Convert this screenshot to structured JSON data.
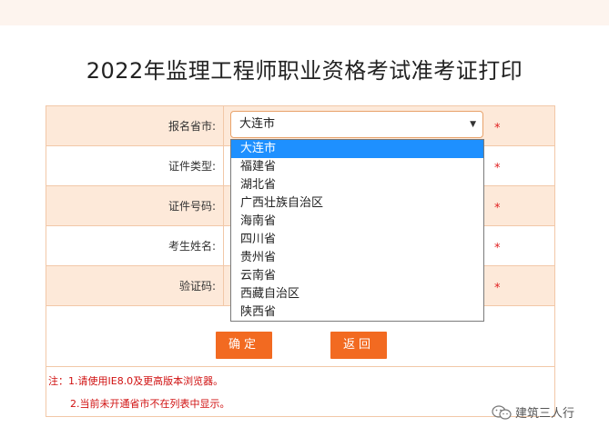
{
  "page": {
    "title": "2022年监理工程师职业资格考试准考证打印"
  },
  "form": {
    "rows": [
      {
        "label": "报名省市:"
      },
      {
        "label": "证件类型:"
      },
      {
        "label": "证件号码:"
      },
      {
        "label": "考生姓名:"
      },
      {
        "label": "验证码:"
      }
    ],
    "required_mark": "*",
    "province_select": {
      "value": "大连市",
      "options": [
        "大连市",
        "福建省",
        "湖北省",
        "广西壮族自治区",
        "海南省",
        "四川省",
        "贵州省",
        "云南省",
        "西藏自治区",
        "陕西省"
      ],
      "selected_index": 0
    }
  },
  "buttons": {
    "confirm": "确定",
    "back": "返回"
  },
  "notes": {
    "line1": "注：1.请使用IE8.0及更高版本浏览器。",
    "line2": "2.当前未开通省市不在列表中显示。"
  },
  "watermark": {
    "text": "建筑三人行"
  },
  "colors": {
    "accent": "#f26a21",
    "required": "#e02020",
    "row_alt": "#fde9d9",
    "border": "#f2c8a8",
    "selected": "#1e90ff"
  }
}
